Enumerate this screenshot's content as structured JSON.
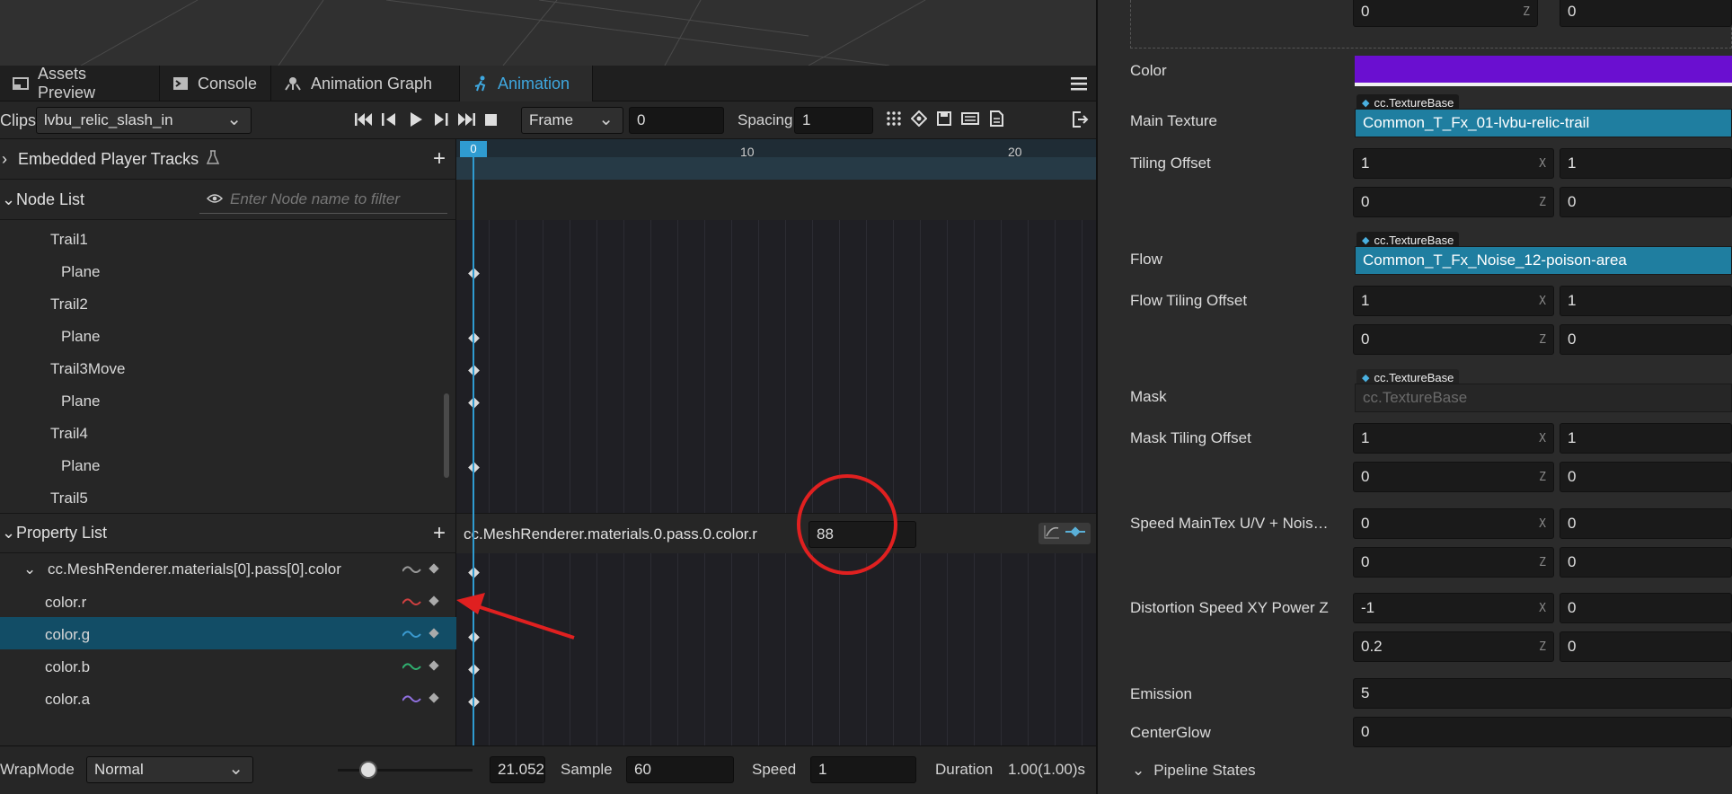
{
  "tabs": [
    {
      "label": "Assets Preview",
      "icon": "image-icon"
    },
    {
      "label": "Console",
      "icon": "terminal-icon"
    },
    {
      "label": "Animation Graph",
      "icon": "graph-icon"
    },
    {
      "label": "Animation",
      "icon": "running-figure-icon",
      "active": true
    }
  ],
  "toolbar": {
    "clips_label": "Clips",
    "clip_value": "lvbu_relic_slash_in",
    "mode_value": "Frame",
    "frame_value": "0",
    "spacing_label": "Spacing",
    "spacing_value": "1"
  },
  "tracks": {
    "embedded_label": "Embedded Player Tracks",
    "node_list_label": "Node List",
    "node_filter_placeholder": "Enter Node name to filter"
  },
  "nodes": [
    "Trail1",
    "Plane",
    "Trail2",
    "Plane",
    "Trail3Move",
    "Plane",
    "Trail4",
    "Plane",
    "Trail5"
  ],
  "timeline": {
    "ticks": [
      "0",
      "10",
      "20"
    ]
  },
  "properties": {
    "label": "Property List",
    "group": "cc.MeshRenderer.materials[0].pass[0].color",
    "items": [
      "color.r",
      "color.g",
      "color.b",
      "color.a"
    ],
    "path_label": "cc.MeshRenderer.materials.0.pass.0.color.r",
    "value": "88"
  },
  "bottom": {
    "wrapmode_label": "WrapMode",
    "wrapmode_value": "Normal",
    "zoom_value": "21.052",
    "sample_label": "Sample",
    "sample_value": "60",
    "speed_label": "Speed",
    "speed_value": "1",
    "duration_label": "Duration",
    "duration_value": "1.00(1.00)s"
  },
  "inspector": {
    "top_row": [
      "0",
      "0"
    ],
    "color_label": "Color",
    "color_value": "#6a0fd0",
    "main_texture_label": "Main Texture",
    "texture_badge": "cc.TextureBase",
    "main_texture_value": "Common_T_Fx_01-lvbu-relic-trail",
    "tiling_label": "Tiling Offset",
    "tiling": [
      "1",
      "1",
      "0",
      "0"
    ],
    "flow_label": "Flow",
    "flow_value": "Common_T_Fx_Noise_12-poison-area",
    "flow_tiling_label": "Flow Tiling Offset",
    "flow_tiling": [
      "1",
      "1",
      "0",
      "0"
    ],
    "mask_label": "Mask",
    "mask_placeholder": "cc.TextureBase",
    "mask_tiling_label": "Mask Tiling Offset",
    "mask_tiling": [
      "1",
      "1",
      "0",
      "0"
    ],
    "speed_label": "Speed MainTex U/V + Nois…",
    "speed": [
      "0",
      "0",
      "0",
      "0"
    ],
    "distortion_label": "Distortion Speed XY Power Z",
    "distortion": [
      "-1",
      "0",
      "0.2",
      "0"
    ],
    "emission_label": "Emission",
    "emission_value": "5",
    "centerglow_label": "CenterGlow",
    "centerglow_value": "0",
    "pipeline_label": "Pipeline States"
  },
  "axis_labels": {
    "x": "X",
    "z": "Z"
  }
}
